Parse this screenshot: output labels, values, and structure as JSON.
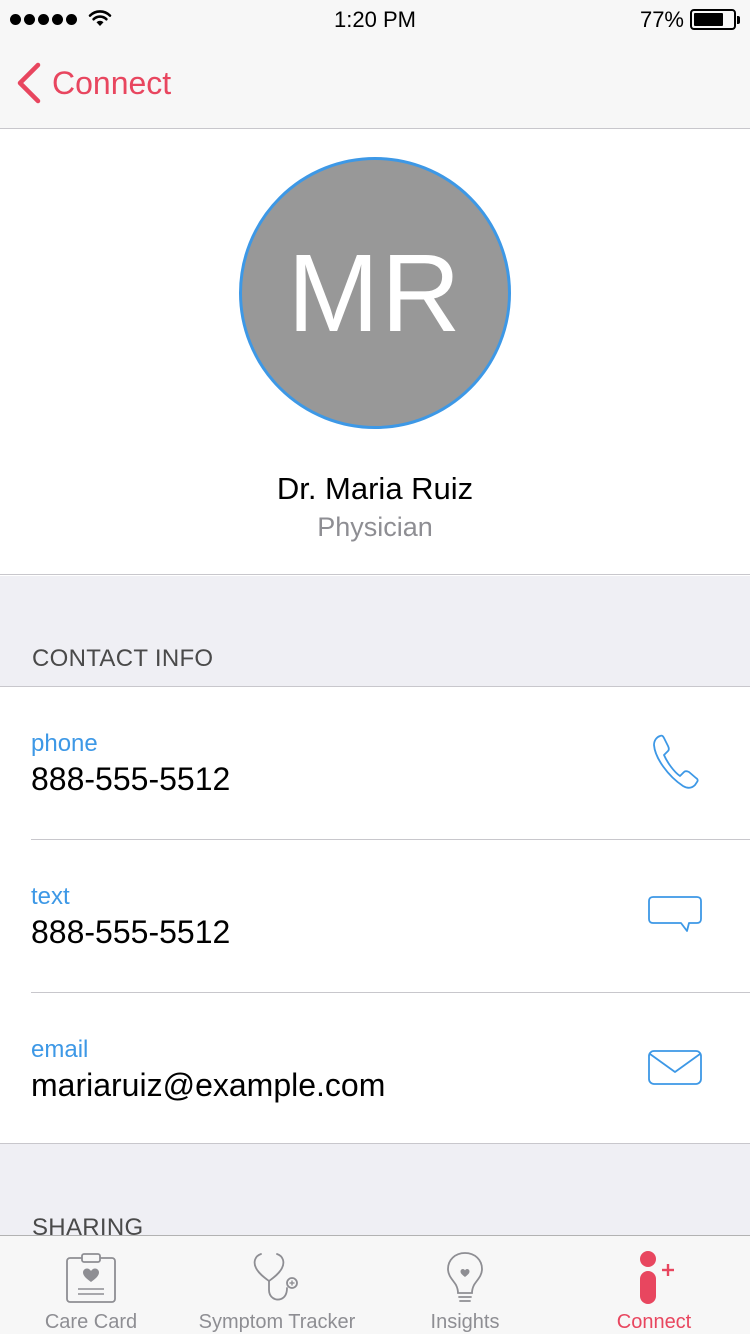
{
  "status_bar": {
    "time": "1:20 PM",
    "battery_percent": "77%",
    "battery_level": 0.77
  },
  "nav": {
    "back_label": "Connect",
    "back_icon": "chevron-left-icon"
  },
  "profile": {
    "initials": "MR",
    "name": "Dr. Maria Ruiz",
    "role": "Physician"
  },
  "sections": {
    "contact_info_title": "CONTACT INFO",
    "sharing_title": "SHARING"
  },
  "contacts": [
    {
      "label": "phone",
      "value": "888-555-5512",
      "icon": "phone-icon"
    },
    {
      "label": "text",
      "value": "888-555-5512",
      "icon": "message-bubble-icon"
    },
    {
      "label": "email",
      "value": "mariaruiz@example.com",
      "icon": "envelope-icon"
    }
  ],
  "tabs": [
    {
      "label": "Care Card",
      "icon": "care-card-icon",
      "active": false
    },
    {
      "label": "Symptom Tracker",
      "icon": "stethoscope-icon",
      "active": false
    },
    {
      "label": "Insights",
      "icon": "lightbulb-icon",
      "active": false
    },
    {
      "label": "Connect",
      "icon": "connect-icon",
      "active": true
    }
  ],
  "colors": {
    "accent": "#e8465f",
    "link_blue": "#3d98e6",
    "avatar_fill": "#989898",
    "grouped_background": "#efeff4",
    "inactive_gray": "#8e8e93"
  }
}
